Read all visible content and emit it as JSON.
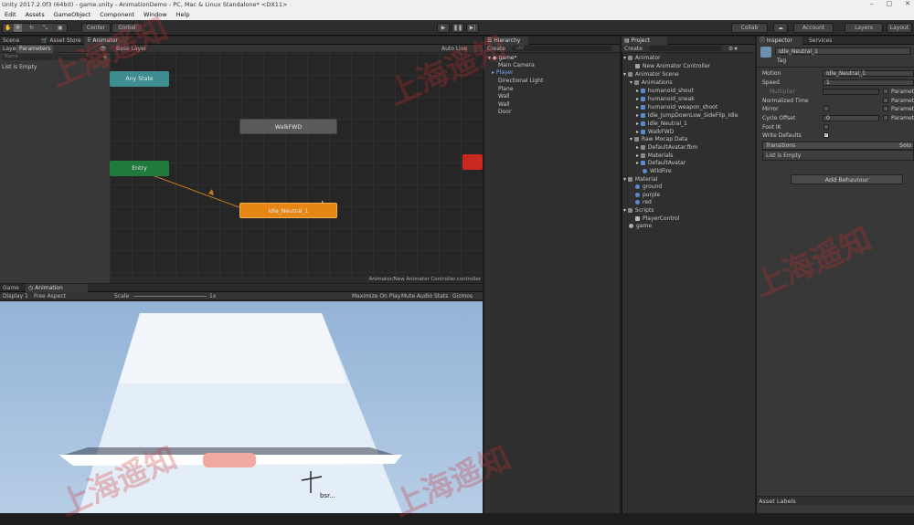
{
  "titlebar": {
    "title": "Unity 2017.2.0f3 (64bit) - game.unity - AnimationDemo - PC, Mac & Linux Standalone* <DX11>",
    "min": "–",
    "max": "□",
    "close": "✕"
  },
  "menu": [
    "Edit",
    "Assets",
    "GameObject",
    "Component",
    "Window",
    "Help"
  ],
  "toolbar": {
    "center": "Center",
    "global": "Global",
    "collab": "Collab",
    "account": "Account",
    "layers": "Layers",
    "layout": "Layout"
  },
  "left_panel": {
    "tab_scene": "Scene",
    "tab_asset_store": "Asset Store",
    "tab_animator": "Animator",
    "sub_layers": "Layers",
    "sub_parameters": "Parameters",
    "search_placeholder": "Name",
    "empty_label": "List is Empty"
  },
  "animator": {
    "base_layer": "Base Layer",
    "auto_live_link": "Auto Live Link",
    "footer": "Animator/New Animator Controller.controller"
  },
  "nodes": {
    "any_state": "Any State",
    "entry": "Entry",
    "walk": "WalkFWD",
    "idle": "Idle_Neutral_1"
  },
  "game": {
    "tab_game": "Game",
    "tab_animation": "Animation",
    "display": "Display 1",
    "aspect": "Free Aspect",
    "scale_label": "Scale",
    "scale_val": "1x",
    "maximize": "Maximize On Play",
    "mute": "Mute Audio",
    "stats": "Stats",
    "gizmos": "Gizmos"
  },
  "hierarchy": {
    "tab": "Hierarchy",
    "create": "Create",
    "search_all": "All",
    "scene": "game*",
    "items": [
      "Main Camera",
      "Player",
      "Directional Light",
      "Plane",
      "Wall",
      "Wall",
      "Door"
    ]
  },
  "project": {
    "tab": "Project",
    "create": "Create",
    "items": [
      "Animator",
      "New Animator Controller",
      "Animator Scene",
      "Animations",
      "humanoid_shout",
      "humanoid_sneak",
      "humanoid_weapon_shoot",
      "Idle_JumpDownLow_SideFlip_Idle",
      "Idle_Neutral_1",
      "WalkFWD",
      "Raw Mocap Data",
      "DefaultAvatar.fbm",
      "Materials",
      "DefaultAvatar",
      "WildFire",
      "Material",
      "ground",
      "purple",
      "red",
      "Scripts",
      "PlayerControl",
      "game"
    ]
  },
  "inspector": {
    "tab": "Inspector",
    "tab_services": "Services",
    "name": "Idle_Neutral_1",
    "tag": "Tag",
    "motion_label": "Motion",
    "motion_value": "Idle_Neutral_1",
    "speed_label": "Speed",
    "speed_value": "1",
    "multiplier": "Multiplier",
    "param": "Parameter",
    "norm_time": "Normalized Time",
    "mirror": "Mirror",
    "cycle_offset": "Cycle Offset",
    "cycle_value": "0",
    "foot_ik": "Foot IK",
    "write_defaults": "Write Defaults",
    "transitions": "Transitions",
    "solo": "Solo",
    "list_empty": "List is Empty",
    "add_behaviour": "Add Behaviour",
    "asset_labels": "Asset Labels"
  },
  "watermark": "上海遥知"
}
